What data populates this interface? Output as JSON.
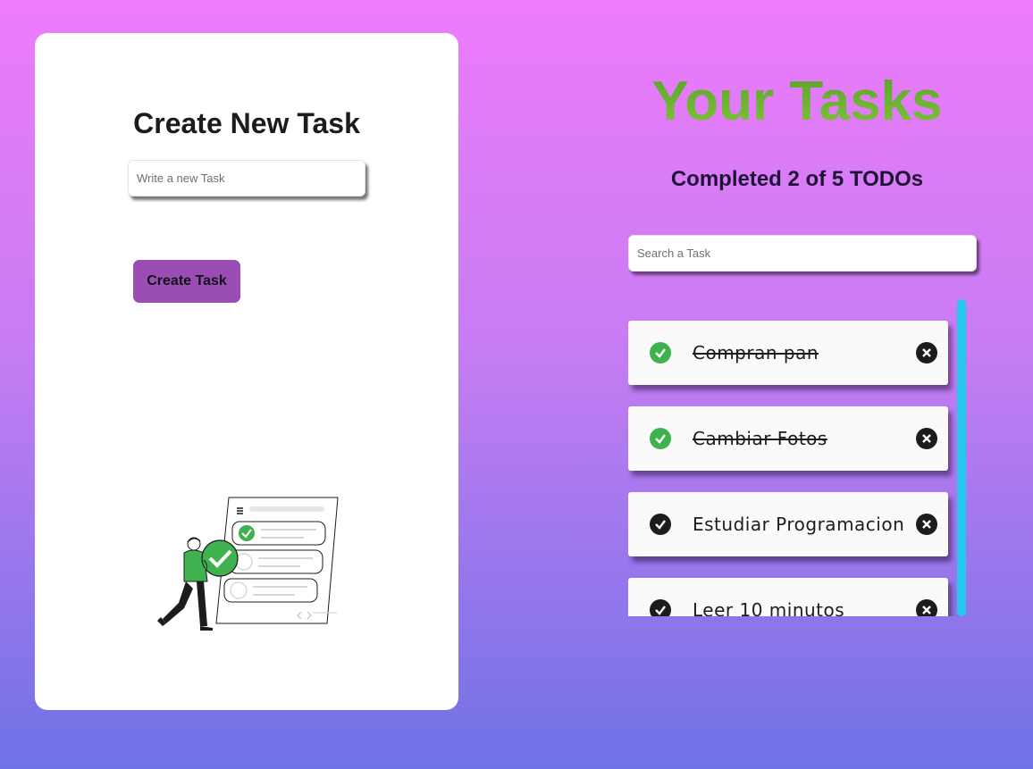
{
  "create_panel": {
    "title": "Create New Task",
    "input_placeholder": "Write a new Task",
    "button_label": "Create Task"
  },
  "tasks_panel": {
    "title": "Your Tasks",
    "counter_prefix": "Completed",
    "completed_count": "2",
    "counter_of": "of",
    "total_count": "5",
    "counter_suffix": "TODOs",
    "search_placeholder": "Search a Task"
  },
  "todos": [
    {
      "text": "Compran pan",
      "completed": true
    },
    {
      "text": "Cambiar Fotos",
      "completed": true
    },
    {
      "text": "Estudiar Programacion",
      "completed": false
    },
    {
      "text": "Leer 10 minutos",
      "completed": false
    }
  ],
  "colors": {
    "background_top": "#ee7bfb",
    "background_bottom": "#6f72e6",
    "button": "#9a4db5",
    "title_green": "#6bb332",
    "check_done": "#3fb14e",
    "check_pending": "#1c1c1c",
    "scrollbar": "#24c8ef"
  },
  "icons": {
    "complete": "check-circle-icon",
    "delete": "x-circle-icon",
    "illustration": "person-checklist-illustration"
  }
}
